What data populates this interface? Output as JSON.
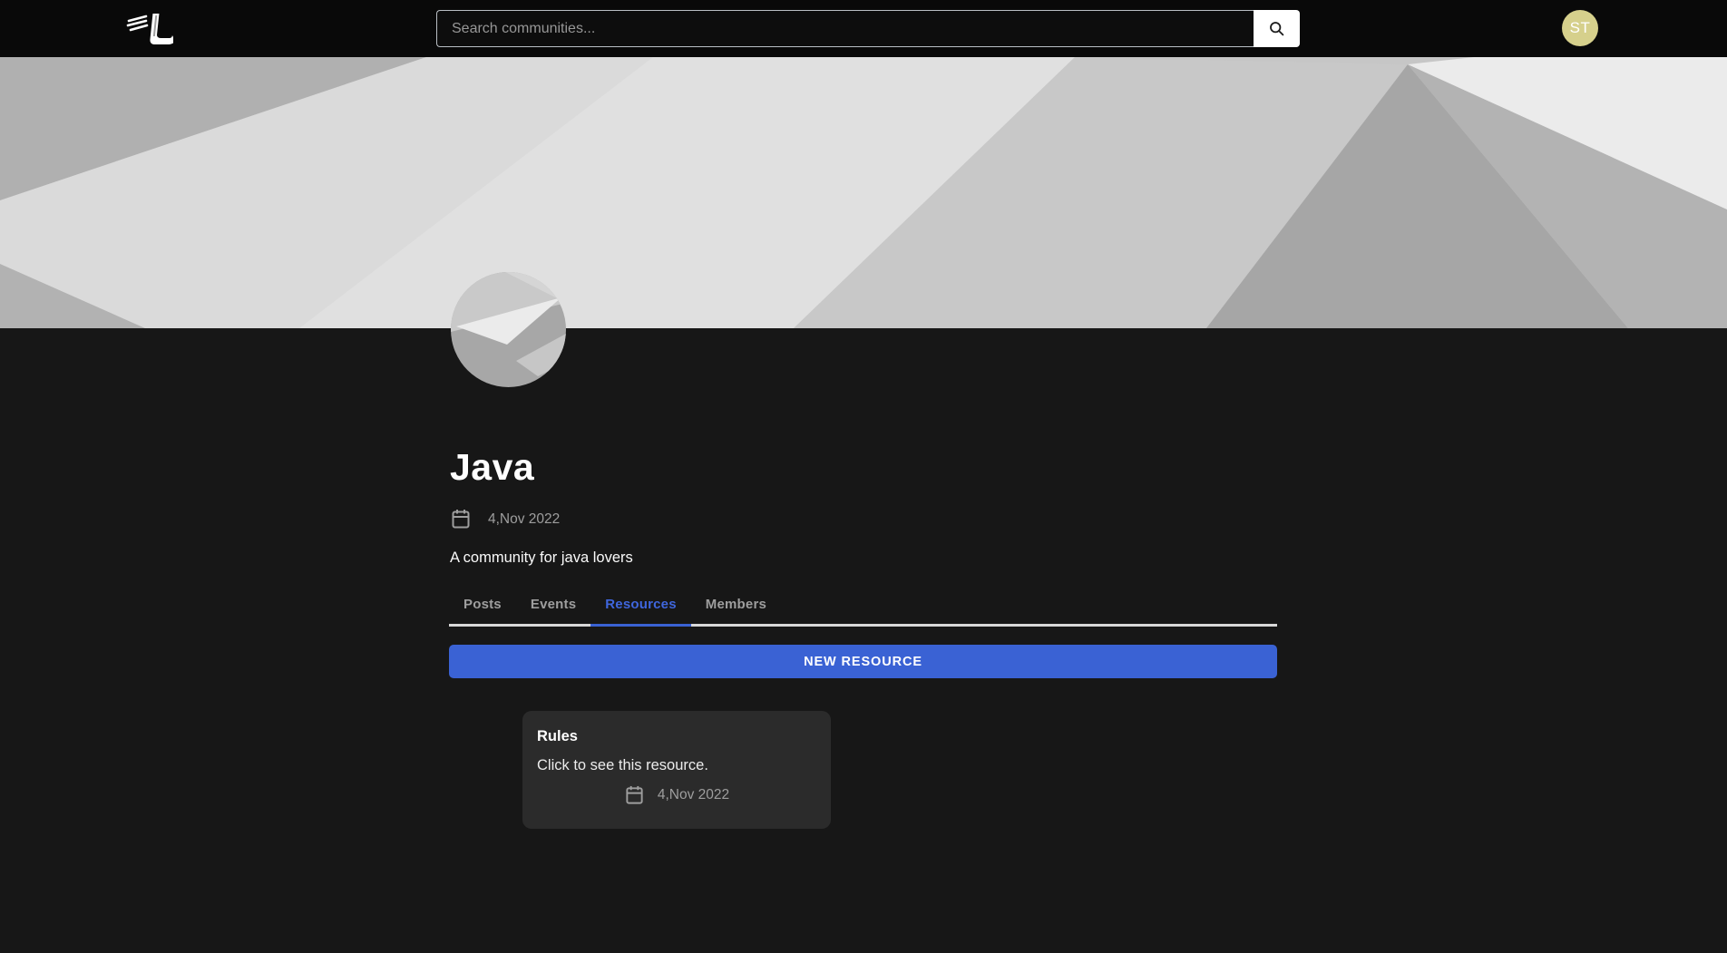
{
  "theme": {
    "accent": "#3a62d4",
    "accent_text": "#3f66dd",
    "page_bg": "#171717",
    "navbar_bg": "#090909",
    "card_bg": "#2b2b2b",
    "muted_text": "#9e9e9e",
    "avatar_bg": "#d6d08c"
  },
  "navbar": {
    "logo_icon": "winged-l-logo",
    "search": {
      "placeholder": "Search communities...",
      "button_icon": "search-icon"
    },
    "user_avatar": {
      "initials": "ST"
    }
  },
  "community": {
    "name": "Java",
    "created_date": "4,Nov 2022",
    "description": "A community for java lovers",
    "date_icon": "calendar-icon"
  },
  "tabs": [
    {
      "label": "Posts",
      "active": false
    },
    {
      "label": "Events",
      "active": false
    },
    {
      "label": "Resources",
      "active": true
    },
    {
      "label": "Members",
      "active": false
    }
  ],
  "actions": {
    "new_resource_label": "NEW RESOURCE"
  },
  "resources": [
    {
      "title": "Rules",
      "subtitle": "Click to see this resource.",
      "date": "4,Nov 2022",
      "date_icon": "calendar-icon"
    }
  ]
}
